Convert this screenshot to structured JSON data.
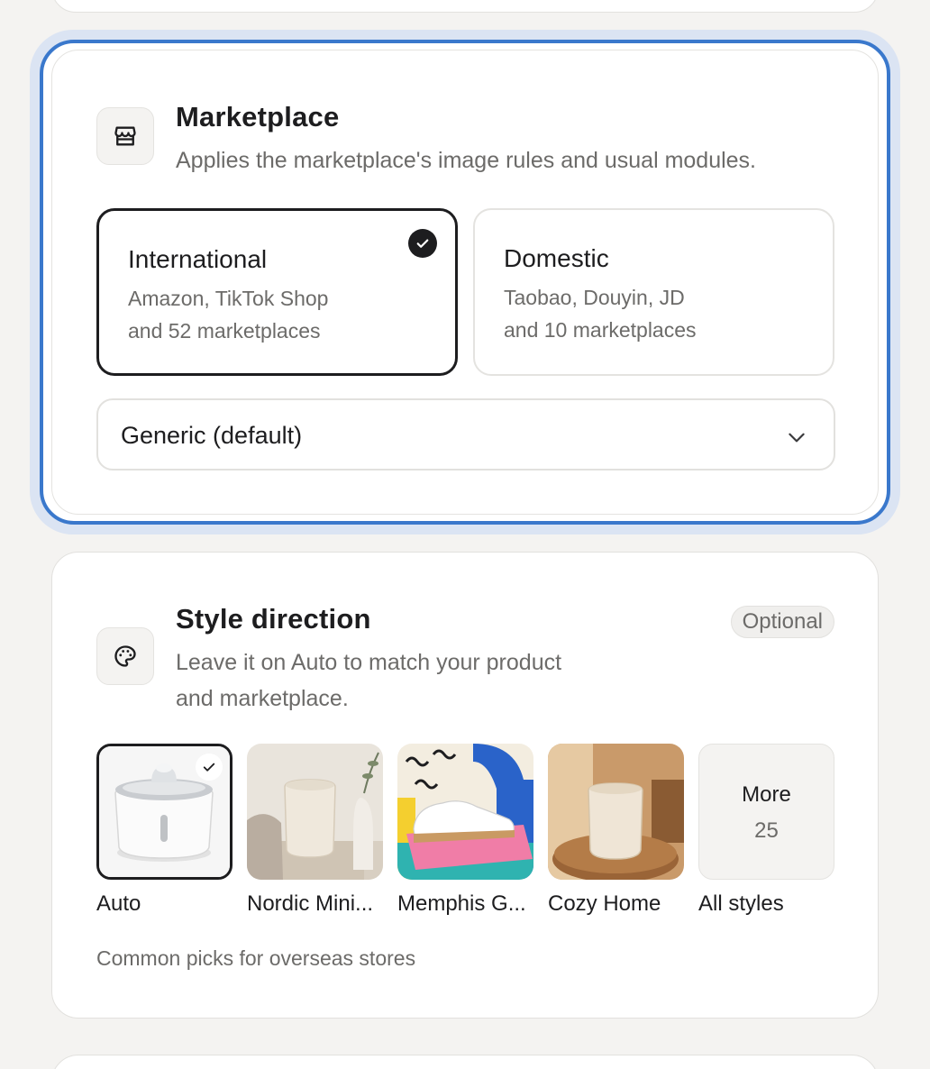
{
  "marketplace": {
    "title": "Marketplace",
    "subtitle": "Applies the marketplace's image rules and usual modules.",
    "icon": "store-icon",
    "options": [
      {
        "title": "International",
        "line1": "Amazon, TikTok Shop",
        "line2": "and 52 marketplaces",
        "selected": true
      },
      {
        "title": "Domestic",
        "line1": "Taobao, Douyin, JD",
        "line2": "and 10 marketplaces",
        "selected": false
      }
    ],
    "select": {
      "value": "Generic (default)"
    },
    "focus_color": "#3a78cc"
  },
  "style": {
    "title": "Style direction",
    "badge": "Optional",
    "subtitle_line1": "Leave it on Auto to match your product",
    "subtitle_line2": "and marketplace.",
    "icon": "palette-icon",
    "styles": [
      {
        "label": "Auto",
        "selected": true
      },
      {
        "label": "Nordic Mini..."
      },
      {
        "label": "Memphis G..."
      },
      {
        "label": "Cozy Home"
      },
      {
        "label": "All styles",
        "more_title": "More",
        "more_count": "25"
      }
    ],
    "footnote": "Common picks for overseas stores"
  }
}
